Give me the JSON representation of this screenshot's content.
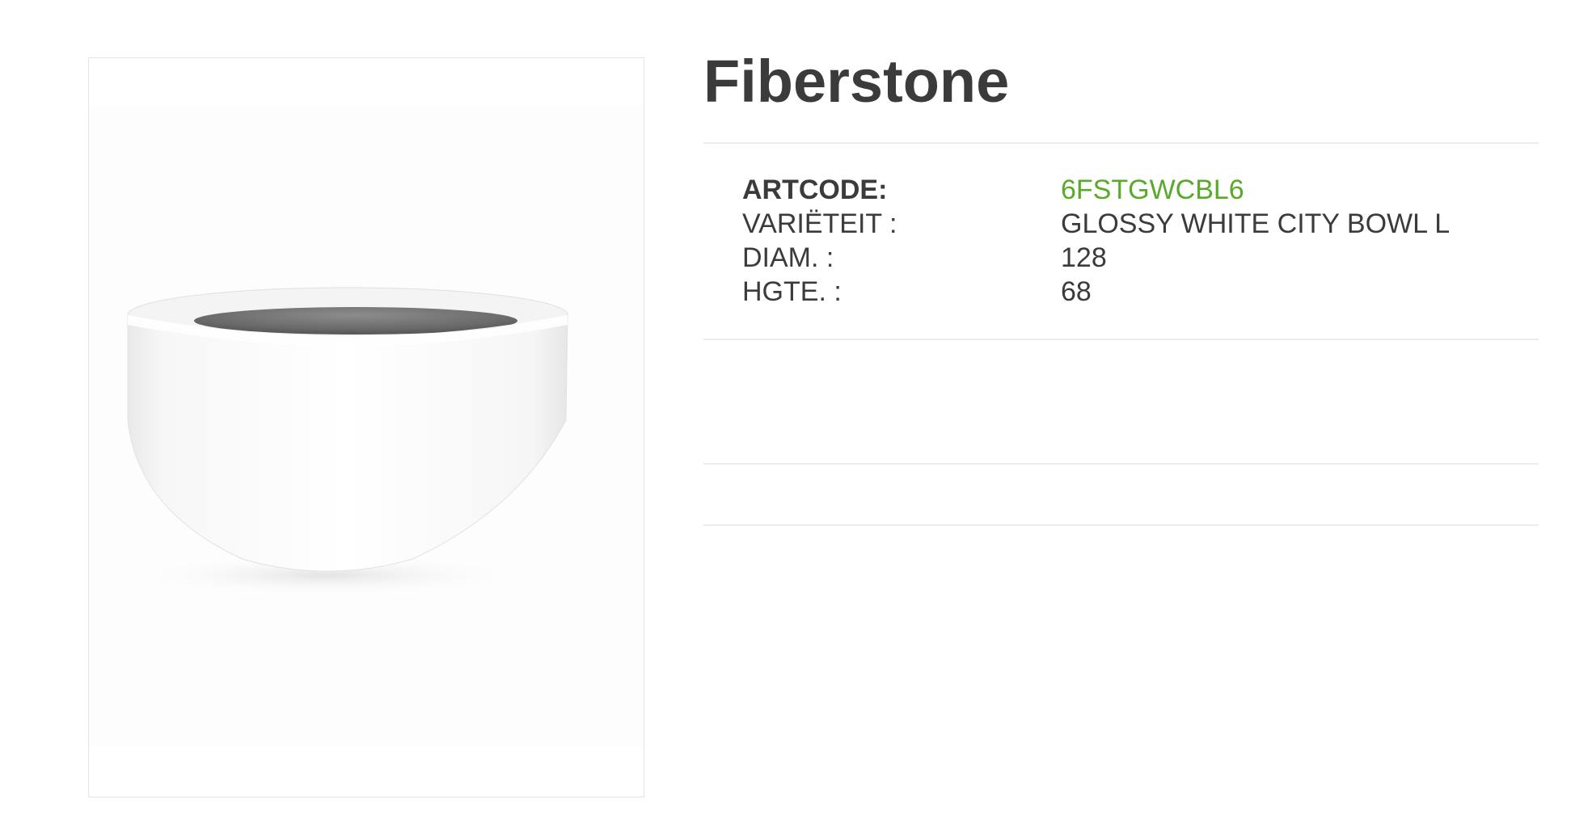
{
  "product": {
    "title": "Fiberstone",
    "image_alt": "product-photo"
  },
  "specs": [
    {
      "label": "ARTCODE:",
      "value": "6FSTGWCBL6",
      "label_bold": true,
      "value_accent": true
    },
    {
      "label": "VARIËTEIT :",
      "value": "GLOSSY WHITE CITY BOWL L"
    },
    {
      "label": "DIAM. :",
      "value": "128"
    },
    {
      "label": "HGTE. :",
      "value": "68"
    }
  ],
  "colors": {
    "text": "#3b3b3b",
    "accent": "#5aaa2a",
    "rule": "#ececec",
    "frame_border": "#e4e4e4"
  }
}
